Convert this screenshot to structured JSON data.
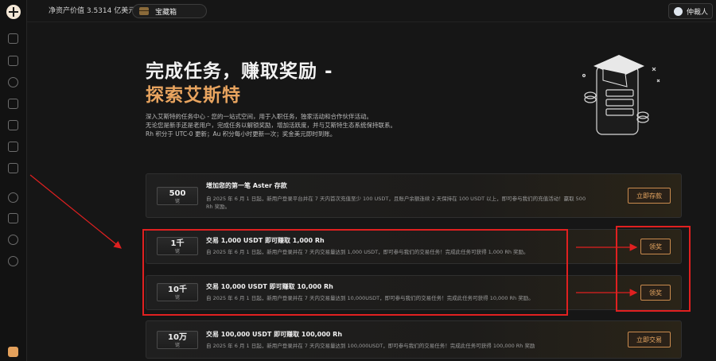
{
  "topbar": {
    "net_value": "净资产价值 3.5314 亿美元",
    "chest_label": "宝藏箱",
    "user_name": "仲裁人"
  },
  "sidebar": {
    "icons": [
      "logo-icon",
      "document-icon",
      "flask-icon",
      "coin-icon",
      "building-icon",
      "chart-icon",
      "trend-icon",
      "gift-icon",
      "chat-icon",
      "file-icon",
      "sparkle-icon",
      "globe-icon",
      "rocket-icon"
    ]
  },
  "hero": {
    "title_line1": "完成任务，赚取奖励 -",
    "title_line2": "探索艾斯特",
    "desc_line1": "深入艾斯特的任务中心 - 您的一站式空间，用于入职任务，独家活动和合作伙伴活动。",
    "desc_line2": "无论您是新手还是老用户，完成任务以解锁奖励，增加活跃度，并与艾斯特生态系统保持联系。",
    "desc_line3": "Rh 积分于 UTC-0 更新；Au 积分每小时更新一次；奖金美元即时到账。"
  },
  "tasks": [
    {
      "badge_num": "500",
      "badge_unit": "铑",
      "title": "增加您的第一笔 Aster 存款",
      "desc_line1": "自 2025 年 6 月 1 日起，新用户登录平台并在 7 天内首次充值至少 100 USDT，且账户余额连续 2 天保持在 100 USDT 以上，即可参与我们的充值活动！赢取 500",
      "desc_line2": "Rh 奖励。",
      "button": "立即存款"
    },
    {
      "badge_num": "1千",
      "badge_unit": "铑",
      "title": "交易 1,000 USDT 即可赚取 1,000 Rh",
      "desc_line1": "自 2025 年 6 月 1 日起，新用户登录并在 7 天内交易量达到 1,000 USDT，即可参与我们的交易任务！完成此任务可获得 1,000 Rh 奖励。",
      "button": "领奖"
    },
    {
      "badge_num": "10千",
      "badge_unit": "铑",
      "title": "交易 10,000 USDT 即可赚取 10,000 Rh",
      "desc_line1": "自 2025 年 6 月 1 日起，新用户登录并在 7 天内交易量达到 10,000USDT，即可参与我们的交易任务！完成此任务可获得 10,000 Rh 奖励。",
      "button": "领奖"
    },
    {
      "badge_num": "10万",
      "badge_unit": "铑",
      "title": "交易 100,000 USDT 即可赚取 100,000 Rh",
      "desc_line1": "自 2025 年 6 月 1 日起，新用户登录并在 7 天内交易量达到 100,000USDT，即可参与我们的交易任务！完成此任务可获得 100,000 Rh 奖励",
      "button": "立即交易"
    }
  ],
  "colors": {
    "accent": "#e8a45f",
    "annotation": "#e02020",
    "background": "#161616"
  }
}
